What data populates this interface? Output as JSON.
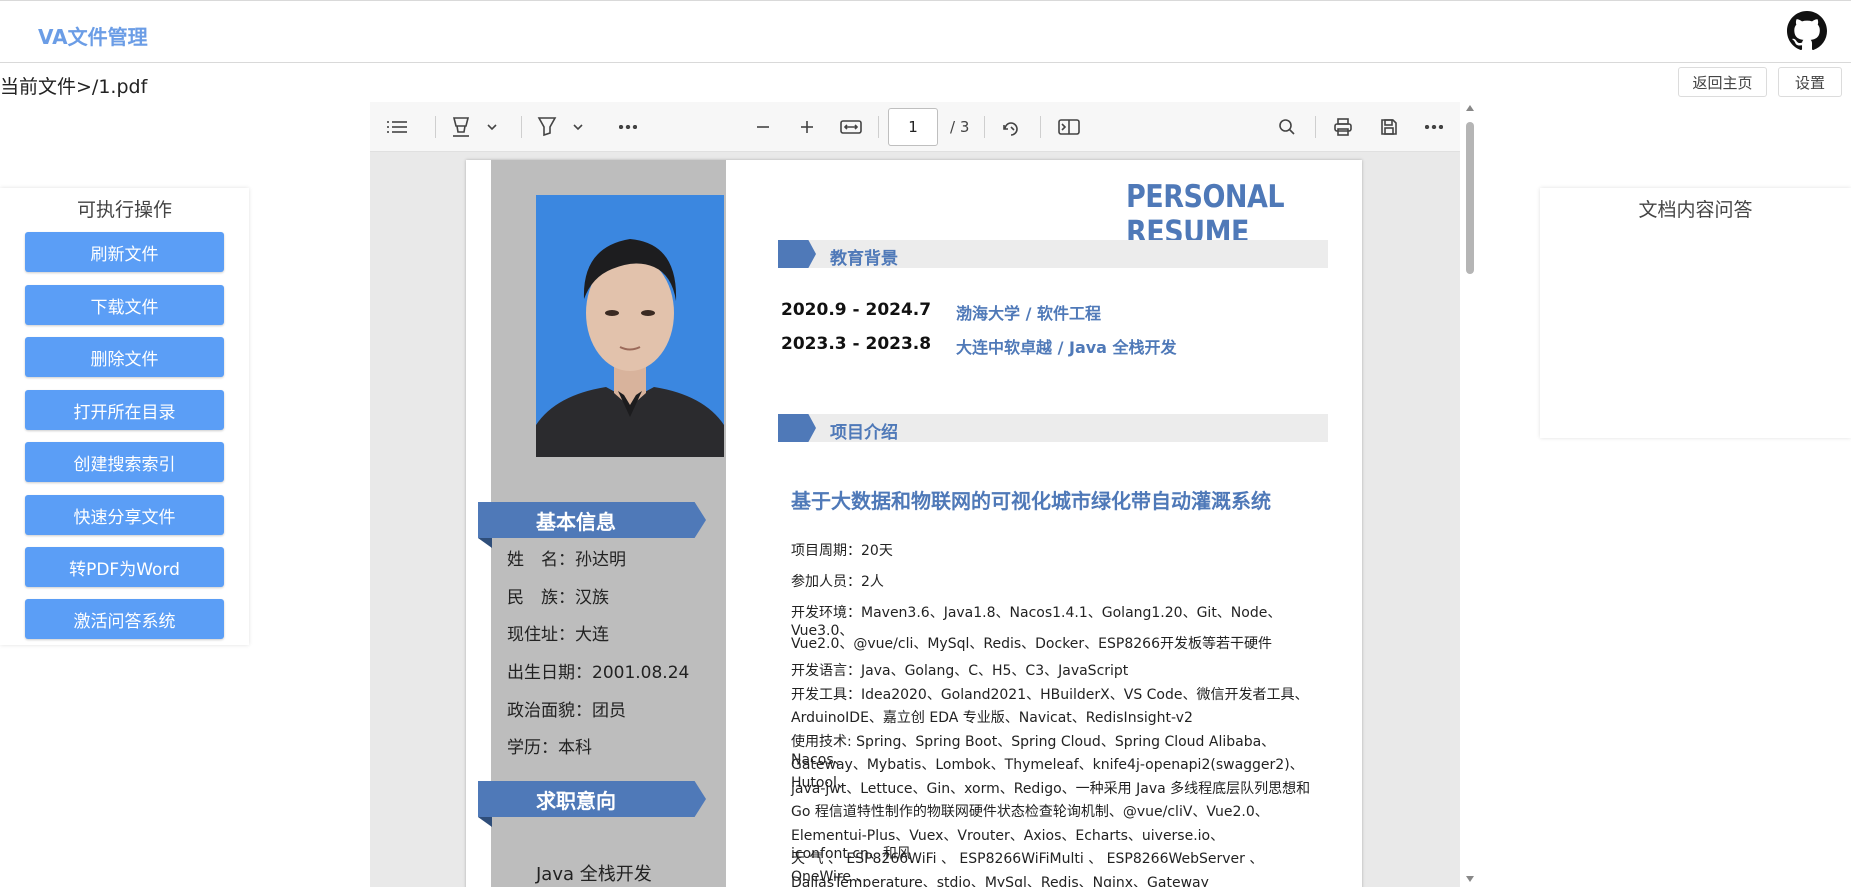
{
  "header": {
    "title": "VA文件管理",
    "github_icon": "github-icon"
  },
  "subbar": {
    "current_file": "当前文件>/1.pdf",
    "home_button": "返回主页",
    "settings_button": "设置"
  },
  "left_panel": {
    "title": "可执行操作",
    "buttons": [
      "刷新文件",
      "下载文件",
      "删除文件",
      "打开所在目录",
      "创建搜索索引",
      "快速分享文件",
      "转PDF为Word",
      "激活问答系统"
    ],
    "button_color": "#5b9ef6"
  },
  "right_panel": {
    "title": "文档内容问答"
  },
  "pdf_toolbar": {
    "page_value": "1",
    "page_total": "/ 3"
  },
  "resume": {
    "title": "PERSONAL RESUME",
    "accent_color": "#4f79b8",
    "education_title": "教育背景",
    "education": [
      {
        "date": "2020.9 - 2024.7",
        "school": "渤海大学 / 软件工程"
      },
      {
        "date": "2023.3 - 2023.8",
        "school": "大连中软卓越 / Java 全栈开发"
      }
    ],
    "project_section_title": "项目介绍",
    "project_title": "基于大数据和物联网的可视化城市绿化带自动灌溉系统",
    "project_details": [
      "项目周期：20天",
      "参加人员：2人",
      "开发环境：Maven3.6、Java1.8、Nacos1.4.1、Golang1.20、Git、Node、Vue3.0、",
      "Vue2.0、@vue/cli、MySql、Redis、Docker、ESP8266开发板等若干硬件",
      "开发语言：Java、Golang、C、H5、C3、JavaScript",
      "开发工具：Idea2020、Goland2021、HBuilderX、VS Code、微信开发者工具、",
      "ArduinoIDE、嘉立创 EDA 专业版、Navicat、RedisInsight-v2",
      "使用技术: Spring、Spring Boot、Spring Cloud、Spring Cloud Alibaba、Nacos、",
      "Gateway、Mybatis、Lombok、Thymeleaf、knife4j-openapi2(swagger2)、Hutool、",
      "java-jwt、Lettuce、Gin、xorm、Redigo、一种采用 Java 多线程底层队列思想和",
      "Go 程信道特性制作的物联网硬件状态检查轮询机制、@vue/cliV、Vue2.0、",
      "Elementui-Plus、Vuex、Vrouter、Axios、Echarts、uiverse.io、iconfont.cn、和风",
      "天 气 、 ESP8266WiFi 、 ESP8266WiFiMulti 、 ESP8266WebServer 、 OneWire 、",
      "DallasTemperature、stdio、MySql、Redis、Nginx、Gateway"
    ],
    "basic_info_title": "基本信息",
    "basic_info": [
      "姓　名：孙达明",
      "民　族：汉族",
      "现住址：大连",
      "出生日期：2001.08.24",
      "政治面貌：团员",
      "学历：本科"
    ],
    "job_intent_title": "求职意向",
    "job_intent": "Java 全栈开发"
  }
}
